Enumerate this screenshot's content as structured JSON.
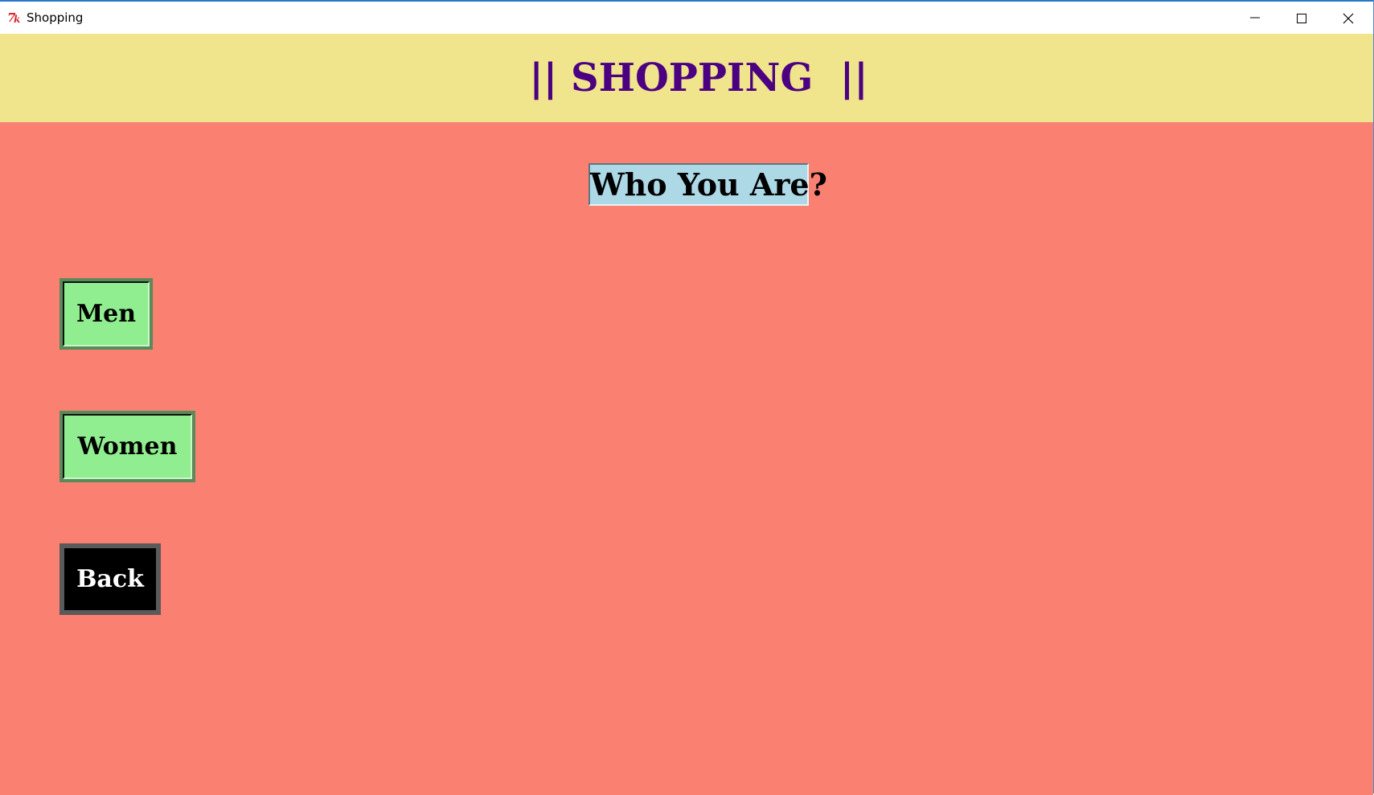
{
  "window": {
    "title": "Shopping",
    "app_icon": "tk-feather-icon",
    "controls": {
      "minimize_icon": "minimize-icon",
      "maximize_icon": "maximize-icon",
      "close_icon": "close-icon"
    }
  },
  "header": {
    "title": "|| SHOPPING  ||"
  },
  "main": {
    "question": "Who You Are?",
    "buttons": {
      "men": "Men",
      "women": "Women",
      "back": "Back"
    }
  },
  "colors": {
    "header_bg": "#f0e48c",
    "header_text": "#4b0082",
    "content_bg": "#fa8072",
    "question_bg": "#add8e6",
    "gender_button_bg": "#90ee90",
    "back_button_bg": "#000000",
    "back_button_text": "#ffffff"
  }
}
